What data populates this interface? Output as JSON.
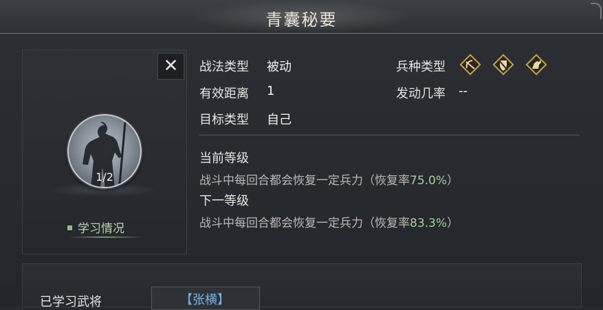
{
  "window": {
    "title": "青囊秘要"
  },
  "portrait": {
    "level": "1/2",
    "study_label": "学习情况",
    "close_symbol": "✕"
  },
  "info": {
    "tactic_type_label": "战法类型",
    "tactic_type_value": "被动",
    "range_label": "有效距离",
    "range_value": "1",
    "target_label": "目标类型",
    "target_value": "自己",
    "unit_type_label": "兵种类型",
    "unit_icons": [
      "archer-icon",
      "shield-icon",
      "cavalry-icon"
    ],
    "trigger_rate_label": "发动几率",
    "trigger_rate_value": "--"
  },
  "levels": {
    "current_title": "当前等级",
    "current_desc_prefix": "战斗中每回合都会恢复一定兵力（恢复率",
    "current_rate": "75.0%",
    "current_desc_suffix": "）",
    "next_title": "下一等级",
    "next_desc_prefix": "战斗中每回合都会恢复一定兵力（恢复率",
    "next_rate": "83.3%",
    "next_desc_suffix": "）"
  },
  "learned": {
    "label": "已学习武将",
    "general_name": "【张横】"
  },
  "colors": {
    "gold_accent": "#c9a24a",
    "highlight_green": "#a9cfa0",
    "general_blue": "#77b3e0"
  }
}
